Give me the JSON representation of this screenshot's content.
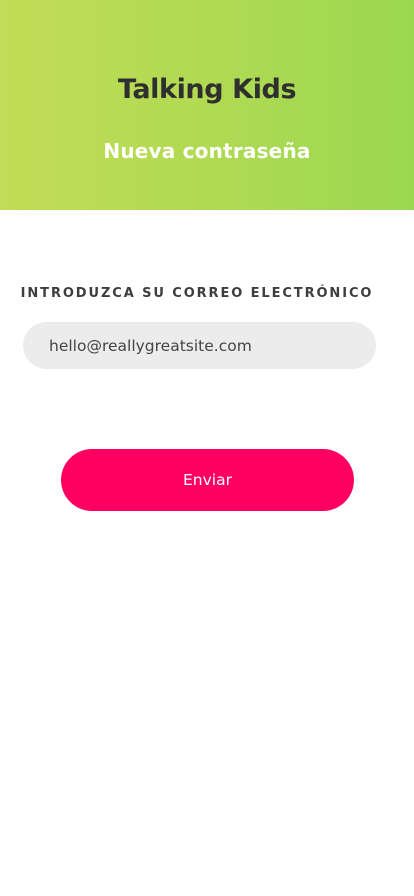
{
  "header": {
    "app_title": "Talking Kids",
    "page_title": "Nueva contraseña",
    "gradient_start": "#c2dd57",
    "gradient_end": "#9bd851"
  },
  "form": {
    "email_label": "INTRODUZCA SU CORREO ELECTRÓNICO",
    "email_value": "hello@reallygreatsite.com",
    "submit_label": "Enviar",
    "submit_color": "#ff0062",
    "field_background": "#ececec"
  }
}
